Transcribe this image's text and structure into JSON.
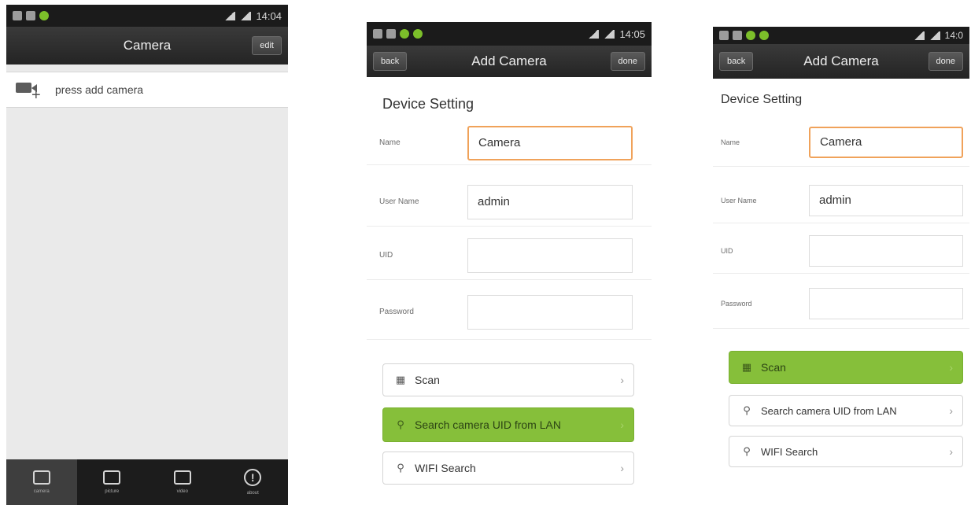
{
  "status": {
    "time1": "14:04",
    "time2": "14:05",
    "time3": "14:0"
  },
  "screen1": {
    "title": "Camera",
    "edit_label": "edit",
    "add_camera_label": "press add camera",
    "tabs": [
      {
        "label": "camera",
        "icon": "camera-grid-icon"
      },
      {
        "label": "picture",
        "icon": "picture-icon"
      },
      {
        "label": "video",
        "icon": "video-icon"
      },
      {
        "label": "about",
        "icon": "info-icon"
      }
    ]
  },
  "add_camera": {
    "title": "Add Camera",
    "back_label": "back",
    "done_label": "done",
    "section_title": "Device Setting",
    "fields": [
      {
        "label": "Name",
        "value": "Camera"
      },
      {
        "label": "User Name",
        "value": "admin"
      },
      {
        "label": "UID",
        "value": ""
      },
      {
        "label": "Password",
        "value": ""
      }
    ],
    "options": [
      {
        "label": "Scan",
        "icon": "scan-icon"
      },
      {
        "label": "Search camera UID from LAN",
        "icon": "search-icon"
      },
      {
        "label": "WIFI Search",
        "icon": "search-icon"
      }
    ]
  },
  "colors": {
    "accent_green": "#86bf3a",
    "focus_orange": "#f0a25a",
    "bar_dark": "#242424"
  }
}
